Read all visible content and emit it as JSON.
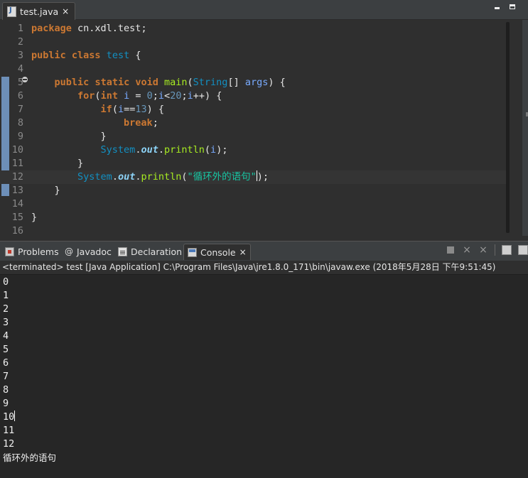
{
  "editor": {
    "tab_label": "test.java",
    "lines": [
      {
        "n": "1",
        "tokens": [
          [
            "kw",
            "package"
          ],
          [
            "plain",
            " cn.xdl.test;"
          ]
        ]
      },
      {
        "n": "2",
        "tokens": []
      },
      {
        "n": "3",
        "tokens": [
          [
            "kw",
            "public"
          ],
          [
            "plain",
            " "
          ],
          [
            "kw",
            "class"
          ],
          [
            "plain",
            " "
          ],
          [
            "cls",
            "test"
          ],
          [
            "plain",
            " {"
          ]
        ]
      },
      {
        "n": "4",
        "tokens": []
      },
      {
        "n": "5",
        "tokens": [
          [
            "plain",
            "    "
          ],
          [
            "kw",
            "public"
          ],
          [
            "plain",
            " "
          ],
          [
            "kw",
            "static"
          ],
          [
            "plain",
            " "
          ],
          [
            "kw",
            "void"
          ],
          [
            "plain",
            " "
          ],
          [
            "fn",
            "main"
          ],
          [
            "plain",
            "("
          ],
          [
            "cls",
            "String"
          ],
          [
            "plain",
            "[] "
          ],
          [
            "var",
            "args"
          ],
          [
            "plain",
            ") {"
          ]
        ]
      },
      {
        "n": "6",
        "tokens": [
          [
            "plain",
            "        "
          ],
          [
            "kw",
            "for"
          ],
          [
            "plain",
            "("
          ],
          [
            "kw",
            "int"
          ],
          [
            "plain",
            " "
          ],
          [
            "var",
            "i"
          ],
          [
            "plain",
            " = "
          ],
          [
            "num",
            "0"
          ],
          [
            "plain",
            ";"
          ],
          [
            "var",
            "i"
          ],
          [
            "plain",
            "<"
          ],
          [
            "num",
            "20"
          ],
          [
            "plain",
            ";"
          ],
          [
            "var",
            "i"
          ],
          [
            "plain",
            "++) {"
          ]
        ]
      },
      {
        "n": "7",
        "tokens": [
          [
            "plain",
            "            "
          ],
          [
            "kw",
            "if"
          ],
          [
            "plain",
            "("
          ],
          [
            "var",
            "i"
          ],
          [
            "plain",
            "=="
          ],
          [
            "num",
            "13"
          ],
          [
            "plain",
            ") {"
          ]
        ]
      },
      {
        "n": "8",
        "tokens": [
          [
            "plain",
            "                "
          ],
          [
            "kw",
            "break"
          ],
          [
            "plain",
            ";"
          ]
        ]
      },
      {
        "n": "9",
        "tokens": [
          [
            "plain",
            "            }"
          ]
        ]
      },
      {
        "n": "10",
        "tokens": [
          [
            "plain",
            "            "
          ],
          [
            "cls",
            "System"
          ],
          [
            "plain",
            "."
          ],
          [
            "fld",
            "out"
          ],
          [
            "plain",
            "."
          ],
          [
            "meth",
            "println"
          ],
          [
            "plain",
            "("
          ],
          [
            "var",
            "i"
          ],
          [
            "plain",
            ");"
          ]
        ]
      },
      {
        "n": "11",
        "tokens": [
          [
            "plain",
            "        }"
          ]
        ]
      },
      {
        "n": "12",
        "tokens": [
          [
            "plain",
            "        "
          ],
          [
            "cls",
            "System"
          ],
          [
            "plain",
            "."
          ],
          [
            "fld",
            "out"
          ],
          [
            "plain",
            "."
          ],
          [
            "meth",
            "println"
          ],
          [
            "plain",
            "("
          ],
          [
            "str",
            "\"循环外的语句\""
          ],
          [
            "plain",
            ");"
          ]
        ]
      },
      {
        "n": "13",
        "tokens": [
          [
            "plain",
            "    }"
          ]
        ]
      },
      {
        "n": "14",
        "tokens": []
      },
      {
        "n": "15",
        "tokens": [
          [
            "plain",
            "}"
          ]
        ]
      },
      {
        "n": "16",
        "tokens": []
      }
    ],
    "current_line": "12"
  },
  "panel": {
    "tabs": [
      {
        "label": "Problems",
        "icon": "problems-icon"
      },
      {
        "label": "Javadoc",
        "icon": "javadoc-icon"
      },
      {
        "label": "Declaration",
        "icon": "declaration-icon"
      },
      {
        "label": "Console",
        "icon": "console-icon",
        "active": true
      }
    ],
    "javadoc_glyph": "@",
    "console_header": "<terminated> test [Java Application] C:\\Program Files\\Java\\jre1.8.0_171\\bin\\javaw.exe (2018年5月28日 下午9:51:45)",
    "output": [
      "0",
      "1",
      "2",
      "3",
      "4",
      "5",
      "6",
      "7",
      "8",
      "9",
      "10",
      "11",
      "12",
      "循环外的语句"
    ]
  },
  "icons": {
    "close": "×"
  },
  "colors": {
    "keyword": "#cc7832",
    "class": "#1290c3",
    "method": "#a7ec21",
    "string": "#17c6a3",
    "number": "#6897bb",
    "variable": "#79abff",
    "field": "#8dd3f7",
    "change_bar": "#6d8fb8"
  }
}
